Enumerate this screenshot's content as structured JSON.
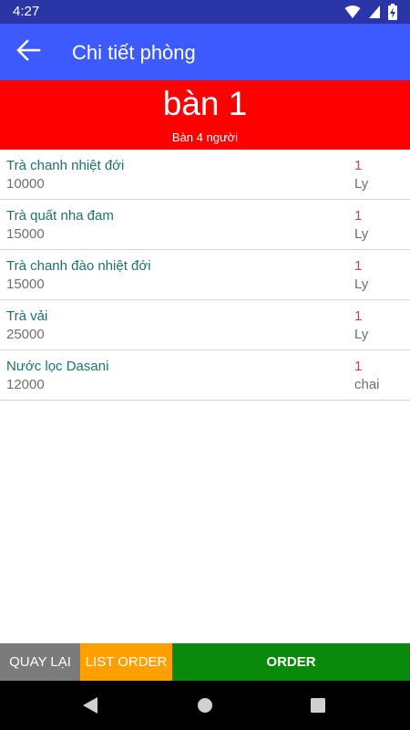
{
  "status_bar": {
    "time": "4:27",
    "icons": [
      "wifi-icon",
      "cell-signal-icon",
      "battery-charging-icon"
    ]
  },
  "app_bar": {
    "title": "Chi tiết phòng",
    "back_icon": "arrow-back-icon"
  },
  "room": {
    "name": "bàn 1",
    "description": "Bàn 4 người"
  },
  "order_items": [
    {
      "name": "Trà chanh nhiệt đới",
      "price": "10000",
      "quantity": "1",
      "unit": "Ly"
    },
    {
      "name": "Trà quất nha đam",
      "price": "15000",
      "quantity": "1",
      "unit": "Ly"
    },
    {
      "name": "Trà chanh đào nhiệt đới",
      "price": "15000",
      "quantity": "1",
      "unit": "Ly"
    },
    {
      "name": "Trà vải",
      "price": "25000",
      "quantity": "1",
      "unit": "Ly"
    },
    {
      "name": "Nước lọc Dasani",
      "price": "12000",
      "quantity": "1",
      "unit": "chai"
    }
  ],
  "buttons": {
    "back": "QUAY LẠI",
    "list_order": "LIST ORDER",
    "order": "ORDER"
  },
  "nav_bar": {
    "icons": [
      "back-triangle-icon",
      "home-circle-icon",
      "recents-square-icon"
    ]
  },
  "colors": {
    "status_bar": "#2a35a8",
    "app_bar": "#3d5afe",
    "banner": "#ff0000",
    "item_name": "#1a7370",
    "quantity": "#e53935",
    "btn_back": "#7b7b7b",
    "btn_list_order": "#ffa000",
    "btn_order": "#0a8a0a"
  }
}
